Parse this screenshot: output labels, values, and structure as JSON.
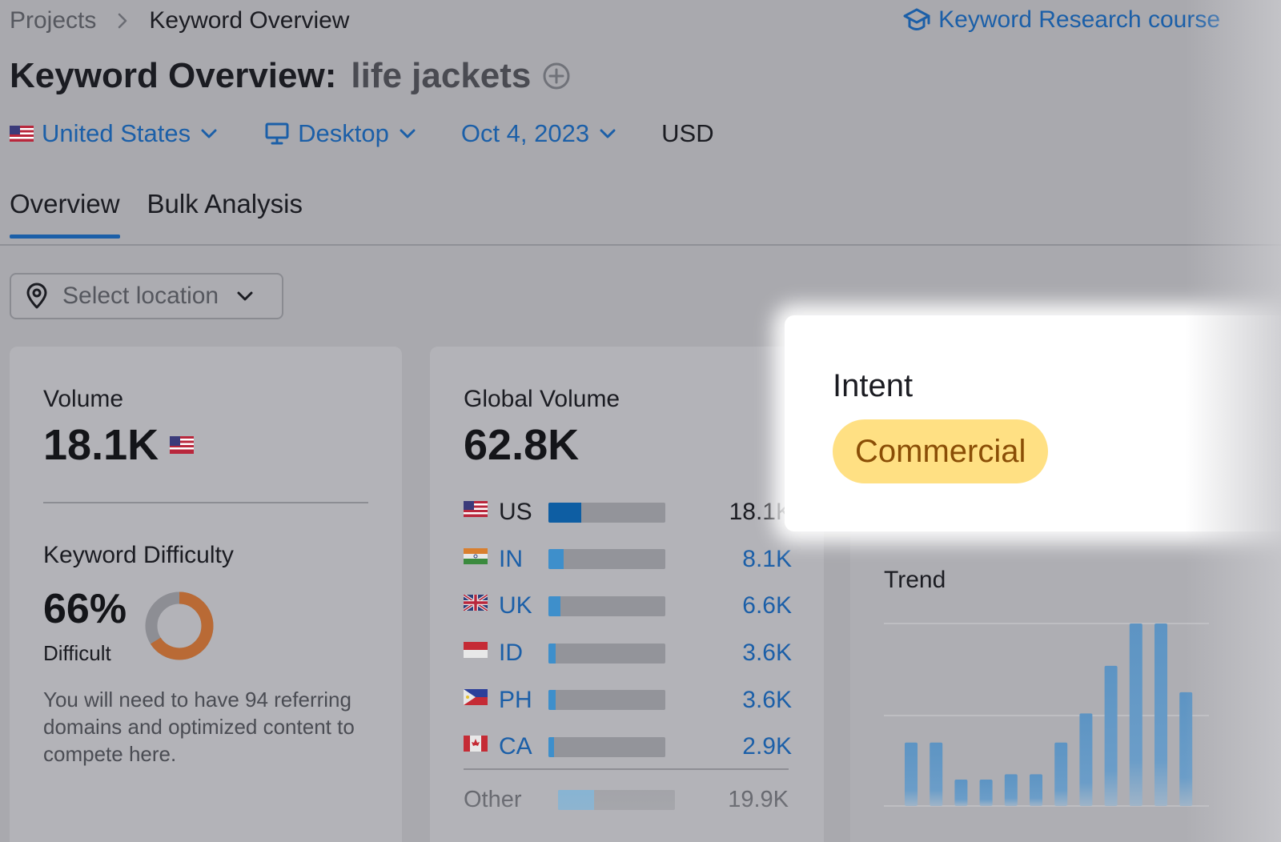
{
  "breadcrumb": {
    "projects": "Projects",
    "current": "Keyword Overview"
  },
  "course_link": {
    "label": "Keyword Research course",
    "icon": "graduation-cap-icon"
  },
  "title": {
    "prefix": "Keyword Overview:",
    "keyword": "life jackets",
    "add_icon": "plus-circle-icon"
  },
  "filters": {
    "country": "United States",
    "device": "Desktop",
    "date": "Oct 4, 2023",
    "currency": "USD"
  },
  "tabs": [
    {
      "label": "Overview",
      "active": true
    },
    {
      "label": "Bulk Analysis",
      "active": false
    }
  ],
  "location_select": {
    "placeholder": "Select location"
  },
  "volume": {
    "label": "Volume",
    "value": "18.1K"
  },
  "keyword_difficulty": {
    "label": "Keyword Difficulty",
    "value": "66%",
    "percent": 66,
    "level": "Difficult",
    "description": "You will need to have 94 referring domains and optimized content to compete here.",
    "color": "#b96a35"
  },
  "global_volume": {
    "label": "Global Volume",
    "value": "62.8K",
    "countries": [
      {
        "code": "US",
        "value": "18.1K",
        "share": 0.28,
        "primary": true
      },
      {
        "code": "IN",
        "value": "8.1K",
        "share": 0.13
      },
      {
        "code": "UK",
        "value": "6.6K",
        "share": 0.1
      },
      {
        "code": "ID",
        "value": "3.6K",
        "share": 0.06
      },
      {
        "code": "PH",
        "value": "3.6K",
        "share": 0.06
      },
      {
        "code": "CA",
        "value": "2.9K",
        "share": 0.05
      }
    ],
    "other": {
      "label": "Other",
      "value": "19.9K",
      "share": 0.31
    }
  },
  "intent": {
    "label": "Intent",
    "value": "Commercial"
  },
  "trend": {
    "label": "Trend",
    "values": [
      48,
      48,
      20,
      20,
      24,
      24,
      48,
      70,
      106,
      138,
      138,
      86
    ],
    "max": 138
  },
  "colors": {
    "accent": "#1b5fa8",
    "bar_primary": "#0e5ea3",
    "bar": "#3e8fcb",
    "intent_badge": "#ffe083",
    "intent_text": "#8a4e06"
  }
}
